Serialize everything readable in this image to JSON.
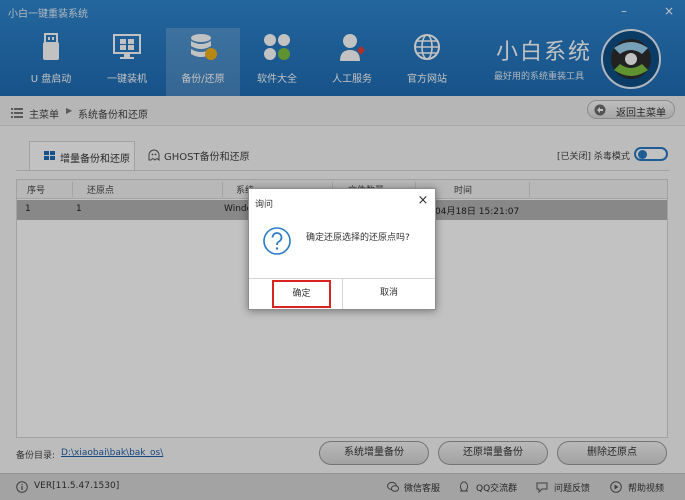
{
  "app": {
    "title": "小白一键重装系统",
    "brand": "小白系统",
    "brand_sub": "最好用的系统重装工具",
    "minimize": "–",
    "close": "×"
  },
  "nav": [
    {
      "label": "U 盘启动",
      "icon": "usb-drive-icon"
    },
    {
      "label": "一键装机",
      "icon": "monitor-windows-icon"
    },
    {
      "label": "备份/还原",
      "icon": "database-backup-icon",
      "active": true
    },
    {
      "label": "软件大全",
      "icon": "apps-grid-icon"
    },
    {
      "label": "人工服务",
      "icon": "support-person-icon"
    },
    {
      "label": "官方网站",
      "icon": "globe-icon"
    }
  ],
  "breadcrumb": {
    "home": "主菜单",
    "separator": "▶",
    "current": "系统备份和还原"
  },
  "back_button": "返回主菜单",
  "tabs": [
    {
      "label": "增量备份和还原",
      "icon": "windows-flag-icon",
      "active": true
    },
    {
      "label": "GHOST备份和还原",
      "icon": "ghost-icon",
      "active": false
    }
  ],
  "mode_toggle": {
    "label": "[已关闭] 杀毒模式",
    "on": false
  },
  "table": {
    "columns": [
      "序号",
      "还原点",
      "系统",
      "文件数量",
      "时间"
    ],
    "rows": [
      {
        "index": "1",
        "point": "1",
        "system": "Windo",
        "count": "",
        "time": "04月18日 15:21:07"
      }
    ]
  },
  "backup_dir": {
    "label": "备份目录:",
    "path": "D:\\xiaobai\\bak\\bak_os\\"
  },
  "actions": [
    "系统增量备份",
    "还原增量备份",
    "删除还原点"
  ],
  "status": {
    "version": "VER[11.5.47.1530]",
    "links": [
      "微信客服",
      "QQ交流群",
      "问题反馈",
      "帮助视频"
    ]
  },
  "dialog": {
    "title": "询问",
    "close": "×",
    "message": "确定还原选择的还原点吗?",
    "ok": "确定",
    "cancel": "取消"
  },
  "colors": {
    "header_blue": "#2b7bc6",
    "selected_row": "#b3b3b3",
    "ok_highlight": "#d9241f",
    "link": "#1f5fa8"
  }
}
